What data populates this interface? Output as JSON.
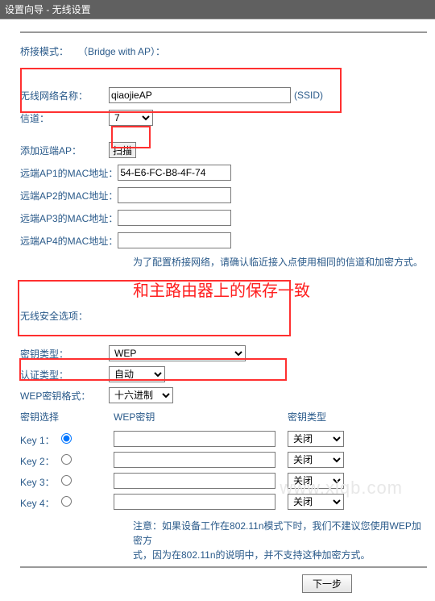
{
  "window_title": "设置向导 - 无线设置",
  "bridge_mode": {
    "label": "桥接模式：",
    "value": "（Bridge with AP）："
  },
  "source_url": "www.xiqb.com",
  "wireless": {
    "ssid_label": "无线网络名称：",
    "ssid_value": "qiaojieAP",
    "ssid_suffix": "(SSID)",
    "channel_label": "信道：",
    "channel_value": "7"
  },
  "remote_ap": {
    "add_label": "添加远端AP：",
    "scan_btn": "扫描",
    "rows": [
      {
        "label": "远端AP1的MAC地址：",
        "value": "54-E6-FC-B8-4F-74"
      },
      {
        "label": "远端AP2的MAC地址：",
        "value": ""
      },
      {
        "label": "远端AP3的MAC地址：",
        "value": ""
      },
      {
        "label": "远端AP4的MAC地址：",
        "value": ""
      }
    ],
    "note": "为了配置桥接网络，请确认临近接入点使用相同的信道和加密方式。"
  },
  "emphasis_text": "和主路由器上的保存一致",
  "security": {
    "section_label": "无线安全选项：",
    "key_type_label": "密钥类型：",
    "key_type_value": "WEP",
    "auth_label": "认证类型：",
    "auth_value": "自动",
    "wep_label": "WEP密钥格式：",
    "wep_value": "十六进制",
    "headers": {
      "select": "密钥选择",
      "key": "WEP密钥",
      "type": "密钥类型"
    },
    "rows": [
      {
        "name": "Key 1：",
        "value": "",
        "type": "关闭",
        "checked": true
      },
      {
        "name": "Key 2：",
        "value": "",
        "type": "关闭",
        "checked": false
      },
      {
        "name": "Key 3：",
        "value": "",
        "type": "关闭",
        "checked": false
      },
      {
        "name": "Key 4：",
        "value": "",
        "type": "关闭",
        "checked": false
      }
    ],
    "note_label": "注意：",
    "note1": "如果设备工作在802.11n模式下时，我们不建议您使用WEP加密方",
    "note2": "式，因为在802.11n的说明中，并不支持这种加密方式。"
  },
  "next_btn": "下一步"
}
